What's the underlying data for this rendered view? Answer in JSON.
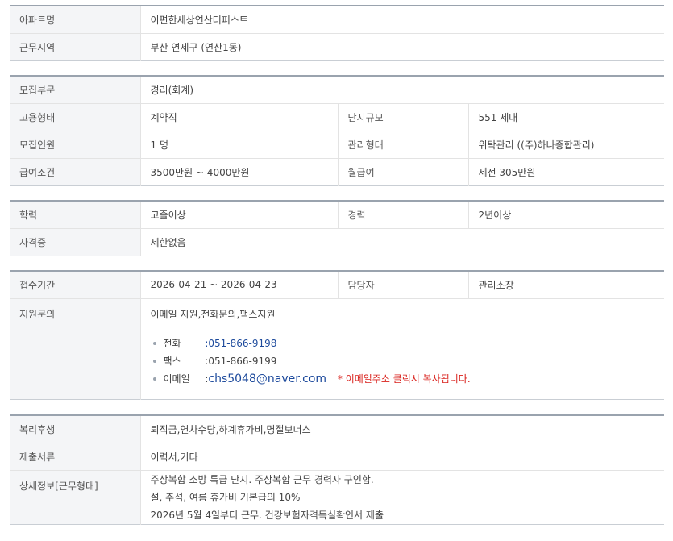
{
  "section1": {
    "apt_label": "아파트명",
    "apt_value": "이편한세상연산더퍼스트",
    "region_label": "근무지역",
    "region_value": "부산  연제구 (연산1동)"
  },
  "section2": {
    "dept_label": "모집부문",
    "dept_value": "경리(회계)",
    "emp_label": "고용형태",
    "emp_value": "계약직",
    "scale_label": "단지규모",
    "scale_value": "551 세대",
    "count_label": "모집인원",
    "count_value": "1 명",
    "mgmt_label": "관리형태",
    "mgmt_value": "위탁관리 ((주)하나종합관리)",
    "salary_label": "급여조건",
    "salary_value": "3500만원 ~ 4000만원",
    "monthly_label": "월급여",
    "monthly_value": "세전 305만원"
  },
  "section3": {
    "edu_label": "학력",
    "edu_value": "고졸이상",
    "career_label": "경력",
    "career_value": "2년이상",
    "cert_label": "자격증",
    "cert_value": "제한없음"
  },
  "section4": {
    "period_label": "접수기간",
    "period_value": "2026-04-21 ~ 2026-04-23",
    "manager_label": "담당자",
    "manager_value": "관리소장",
    "inquiry_label": "지원문의",
    "inquiry_value": "이메일 지원,전화문의,팩스지원",
    "phone_label": "전화",
    "phone_value": ":051-866-9198",
    "fax_label": "팩스",
    "fax_value": ":051-866-9199",
    "email_label": "이메일",
    "email_value": "chs5048@naver.com",
    "email_colon": ":",
    "email_notice": "* 이메일주소 클릭시 복사됩니다."
  },
  "section5": {
    "welfare_label": "복리후생",
    "welfare_value": "퇴직금,연차수당,하계휴가비,명절보너스",
    "docs_label": "제출서류",
    "docs_value": "이력서,기타",
    "detail_label": "상세정보[근무형태]",
    "detail_lines": [
      "주상복합 소방 특급 단지. 주상복합 근무 경력자 구인함.",
      "설, 추석, 여름 휴가비 기본급의 10%",
      "2026년 5월 4일부터 근무. 건강보험자격득실확인서 제출"
    ]
  },
  "colors": {
    "link": "#1d4a9c",
    "notice": "#d9211c",
    "label_bg": "#f4f5f7"
  }
}
